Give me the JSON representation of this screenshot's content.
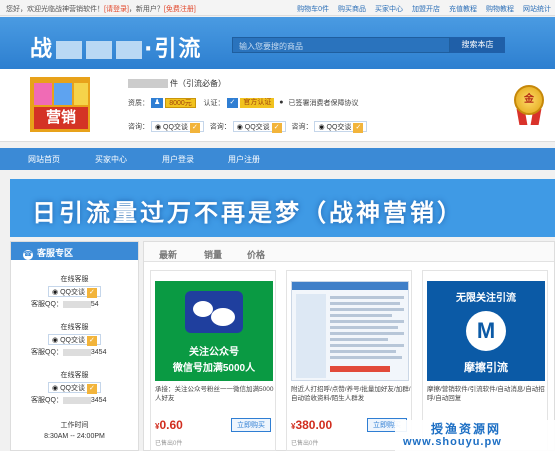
{
  "topbar": {
    "greeting": "您好，欢迎光临战神营销软件！",
    "login": "[请登录]",
    "new_user": "，新用户？",
    "register": "[免费注册]",
    "links": [
      "购物车0件",
      "购买商品",
      "买家中心",
      "加盟开店",
      "充值教程",
      "购物教程",
      "网站统计"
    ]
  },
  "header": {
    "logo_prefix": "战",
    "logo_suffix": "·引流",
    "search_placeholder": "输入您要搜的商品",
    "search_button": "搜索本店"
  },
  "shop": {
    "logo_text": "营销",
    "name_suffix": "件（引流必备）",
    "qualification_label": "资质：",
    "level_badge": "8000元",
    "auth_label": "认证：",
    "auth_badge": "官方认证",
    "protect_text": "已签署消费者保障协议",
    "consult_label": "咨询：",
    "qq_label": "QQ交谈",
    "medal_text": "金"
  },
  "nav": {
    "items": [
      "网站首页",
      "买家中心",
      "用户登录",
      "用户注册"
    ]
  },
  "banner": {
    "text": "日引流量过万不再是梦（战神营销）"
  },
  "sidebar": {
    "title": "客服专区",
    "online_label": "在线客服",
    "qq_label": "QQ交谈",
    "service_prefix": "客服QQ：",
    "numbers": [
      "54",
      "3454",
      "3454"
    ],
    "hours_label": "工作时间",
    "hours": "8:30AM -- 24:00PM"
  },
  "tabs": [
    "最新",
    "销量",
    "价格"
  ],
  "products": [
    {
      "img_line1": "关注公众号",
      "img_line2": "微信号加满5000人",
      "title": "承接：关注公众号粉丝一一微信加满5000人好友",
      "price": "0.60",
      "buy": "立即购买",
      "sold": "已售出0件"
    },
    {
      "title": "附近人打招呼/点赞/养号/批量加好友/加群/自动验收资料/陌生人群发",
      "price": "380.00",
      "buy": "立即购买",
      "sold": "已售出0件"
    },
    {
      "img_line1": "无限关注引流",
      "img_logo": "M",
      "img_line2": "摩擦引流",
      "title": "摩擦/营销软件/引流软件/自动消息/自动招呼/自动回复",
      "price": "",
      "buy": "",
      "sold": ""
    }
  ],
  "watermark": {
    "line1": "授渔资源网",
    "line2": "www.shouyu.pw"
  }
}
